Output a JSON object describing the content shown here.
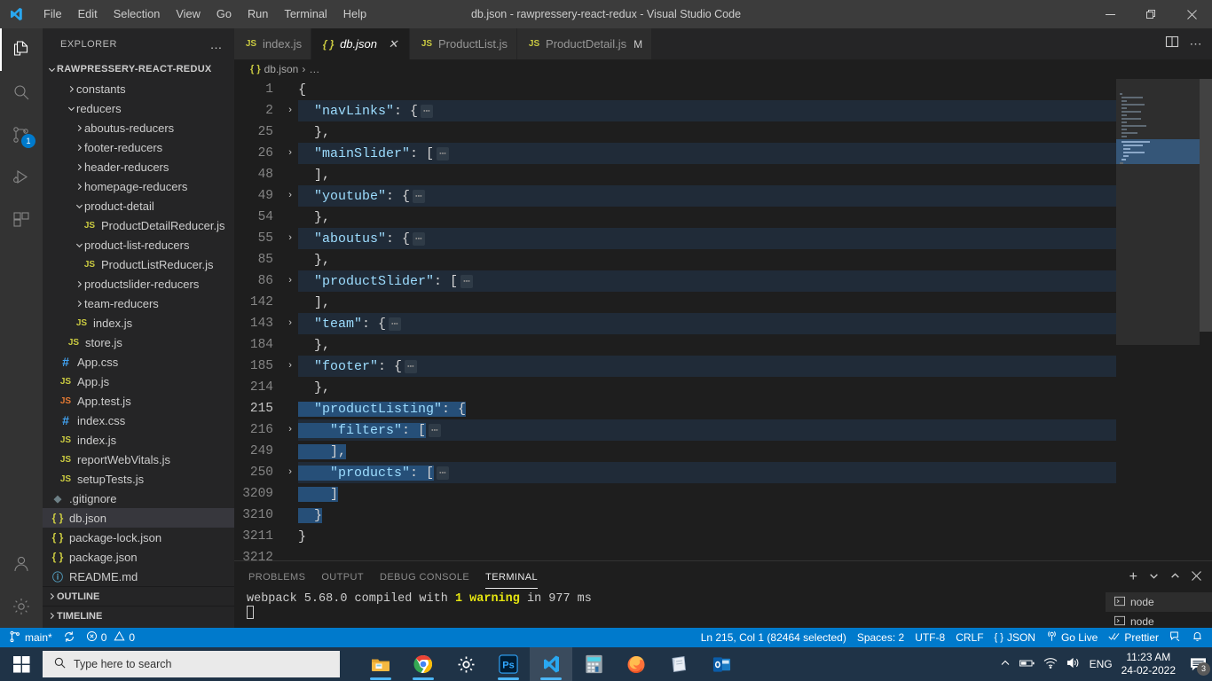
{
  "titlebar": {
    "logo_icon": "vscode-logo-icon",
    "menus": [
      "File",
      "Edit",
      "Selection",
      "View",
      "Go",
      "Run",
      "Terminal",
      "Help"
    ],
    "window_title": "db.json - rawpressery-react-redux - Visual Studio Code",
    "minimize_icon": "minimize-icon",
    "maximize_icon": "restore-icon",
    "close_icon": "close-icon"
  },
  "activitybar": {
    "items": [
      {
        "icon": "explorer-files-icon",
        "active": true,
        "badge": ""
      },
      {
        "icon": "search-icon",
        "active": false,
        "badge": ""
      },
      {
        "icon": "source-control-icon",
        "active": false,
        "badge": "1"
      },
      {
        "icon": "run-and-debug-icon",
        "active": false,
        "badge": ""
      },
      {
        "icon": "extensions-icon",
        "active": false,
        "badge": ""
      }
    ],
    "bottom": [
      {
        "icon": "accounts-icon"
      },
      {
        "icon": "gear-icon"
      }
    ]
  },
  "sidebar": {
    "title": "EXPLORER",
    "more_actions": "…",
    "root": "RAWPRESSERY-REACT-REDUX",
    "tree": [
      {
        "label": "constants",
        "type": "folder",
        "depth": 2,
        "expanded": false
      },
      {
        "label": "reducers",
        "type": "folder",
        "depth": 2,
        "expanded": true
      },
      {
        "label": "aboutus-reducers",
        "type": "folder",
        "depth": 3,
        "expanded": false
      },
      {
        "label": "footer-reducers",
        "type": "folder",
        "depth": 3,
        "expanded": false
      },
      {
        "label": "header-reducers",
        "type": "folder",
        "depth": 3,
        "expanded": false
      },
      {
        "label": "homepage-reducers",
        "type": "folder",
        "depth": 3,
        "expanded": false
      },
      {
        "label": "product-detail",
        "type": "folder",
        "depth": 3,
        "expanded": true
      },
      {
        "label": "ProductDetailReducer.js",
        "type": "js",
        "depth": 4
      },
      {
        "label": "product-list-reducers",
        "type": "folder",
        "depth": 3,
        "expanded": true
      },
      {
        "label": "ProductListReducer.js",
        "type": "js",
        "depth": 4
      },
      {
        "label": "productslider-reducers",
        "type": "folder",
        "depth": 3,
        "expanded": false
      },
      {
        "label": "team-reducers",
        "type": "folder",
        "depth": 3,
        "expanded": false
      },
      {
        "label": "index.js",
        "type": "js",
        "depth": 3
      },
      {
        "label": "store.js",
        "type": "js",
        "depth": 2
      },
      {
        "label": "App.css",
        "type": "css",
        "depth": 1
      },
      {
        "label": "App.js",
        "type": "js",
        "depth": 1
      },
      {
        "label": "App.test.js",
        "type": "jstest",
        "depth": 1
      },
      {
        "label": "index.css",
        "type": "css",
        "depth": 1
      },
      {
        "label": "index.js",
        "type": "js",
        "depth": 1
      },
      {
        "label": "reportWebVitals.js",
        "type": "js",
        "depth": 1
      },
      {
        "label": "setupTests.js",
        "type": "js",
        "depth": 1
      },
      {
        "label": ".gitignore",
        "type": "git",
        "depth": 0
      },
      {
        "label": "db.json",
        "type": "json",
        "depth": 0,
        "selected": true
      },
      {
        "label": "package-lock.json",
        "type": "json",
        "depth": 0
      },
      {
        "label": "package.json",
        "type": "json",
        "depth": 0
      },
      {
        "label": "README.md",
        "type": "md",
        "depth": 0
      }
    ],
    "sections": [
      "OUTLINE",
      "TIMELINE"
    ]
  },
  "editor": {
    "tabs": [
      {
        "label": "index.js",
        "icon": "js-file-icon",
        "active": false,
        "dirty": false,
        "modified": ""
      },
      {
        "label": "db.json",
        "icon": "json-file-icon",
        "active": true,
        "dirty": false,
        "modified": ""
      },
      {
        "label": "ProductList.js",
        "icon": "js-file-icon",
        "active": false,
        "dirty": false,
        "modified": ""
      },
      {
        "label": "ProductDetail.js",
        "icon": "js-file-icon",
        "active": false,
        "dirty": false,
        "modified": "M"
      }
    ],
    "close_icon": "close-icon",
    "split_editor_icon": "split-editor-icon",
    "more_actions_icon": "more-actions-icon",
    "breadcrumb": {
      "file": "db.json",
      "separator": "›",
      "rest": "…"
    },
    "lines": [
      {
        "num": "1",
        "fold": "",
        "indent": 0,
        "code": "{",
        "type": "plain"
      },
      {
        "num": "2",
        "fold": "›",
        "indent": 1,
        "key": "\"navLinks\"",
        "after": ": {",
        "folded": true
      },
      {
        "num": "25",
        "fold": "",
        "indent": 1,
        "code": "},",
        "type": "plain"
      },
      {
        "num": "26",
        "fold": "›",
        "indent": 1,
        "key": "\"mainSlider\"",
        "after": ": [",
        "folded": true
      },
      {
        "num": "48",
        "fold": "",
        "indent": 1,
        "code": "],",
        "type": "plain"
      },
      {
        "num": "49",
        "fold": "›",
        "indent": 1,
        "key": "\"youtube\"",
        "after": ": {",
        "folded": true
      },
      {
        "num": "54",
        "fold": "",
        "indent": 1,
        "code": "},",
        "type": "plain"
      },
      {
        "num": "55",
        "fold": "›",
        "indent": 1,
        "key": "\"aboutus\"",
        "after": ": {",
        "folded": true
      },
      {
        "num": "85",
        "fold": "",
        "indent": 1,
        "code": "},",
        "type": "plain"
      },
      {
        "num": "86",
        "fold": "›",
        "indent": 1,
        "key": "\"productSlider\"",
        "after": ": [",
        "folded": true
      },
      {
        "num": "142",
        "fold": "",
        "indent": 1,
        "code": "],",
        "type": "plain"
      },
      {
        "num": "143",
        "fold": "›",
        "indent": 1,
        "key": "\"team\"",
        "after": ": {",
        "folded": true
      },
      {
        "num": "184",
        "fold": "",
        "indent": 1,
        "code": "},",
        "type": "plain"
      },
      {
        "num": "185",
        "fold": "›",
        "indent": 1,
        "key": "\"footer\"",
        "after": ": {",
        "folded": true
      },
      {
        "num": "214",
        "fold": "",
        "indent": 1,
        "code": "},",
        "type": "plain"
      },
      {
        "num": "215",
        "fold": "",
        "indent": 1,
        "key": "\"productListing\"",
        "after": ": {",
        "selected": true,
        "current": true
      },
      {
        "num": "216",
        "fold": "›",
        "indent": 2,
        "key": "\"filters\"",
        "after": ": [",
        "folded": true,
        "selected": true
      },
      {
        "num": "249",
        "fold": "",
        "indent": 2,
        "code": "],",
        "type": "plain",
        "selected": true
      },
      {
        "num": "250",
        "fold": "›",
        "indent": 2,
        "key": "\"products\"",
        "after": ": [",
        "folded": true,
        "selected": true
      },
      {
        "num": "3209",
        "fold": "",
        "indent": 2,
        "code": "]",
        "type": "plain",
        "selected": true
      },
      {
        "num": "3210",
        "fold": "",
        "indent": 1,
        "code": "}",
        "type": "plain",
        "selected": true
      },
      {
        "num": "3211",
        "fold": "",
        "indent": 0,
        "code": "}",
        "type": "plain"
      },
      {
        "num": "3212",
        "fold": "",
        "indent": 0,
        "code": "",
        "type": "plain"
      }
    ]
  },
  "panel": {
    "tabs": [
      "PROBLEMS",
      "OUTPUT",
      "DEBUG CONSOLE",
      "TERMINAL"
    ],
    "active_tab": "TERMINAL",
    "actions": {
      "new_terminal_icon": "plus-icon",
      "terminal_dropdown_icon": "chevron-down-icon",
      "maximize_icon": "chevron-up-icon",
      "close_icon": "close-icon"
    },
    "terminal_output": {
      "prefix": "webpack 5.68.0 compiled with ",
      "warning": "1 warning",
      "suffix": " in 977 ms"
    },
    "terminal_list": [
      {
        "label": "node",
        "icon": "terminal-icon",
        "active": true
      },
      {
        "label": "node",
        "icon": "terminal-icon",
        "active": false
      }
    ]
  },
  "statusbar": {
    "left": [
      {
        "icon": "remote-branch-icon",
        "label": "main*"
      },
      {
        "icon": "sync-icon",
        "label": ""
      },
      {
        "icon": "error-icon",
        "label": "0",
        "icon2": "warning-icon",
        "label2": "0"
      }
    ],
    "branch": "main*",
    "errors": "0",
    "warnings": "0",
    "right": [
      {
        "name": "cursor-position",
        "label": "Ln 215, Col 1 (82464 selected)"
      },
      {
        "name": "indentation",
        "label": "Spaces: 2"
      },
      {
        "name": "encoding",
        "label": "UTF-8"
      },
      {
        "name": "eol",
        "label": "CRLF"
      },
      {
        "name": "language-mode",
        "label": "JSON",
        "icon": "json-icon"
      },
      {
        "name": "go-live",
        "label": "Go Live",
        "icon": "broadcast-icon"
      },
      {
        "name": "prettier",
        "label": "Prettier",
        "icon": "check-check-icon"
      },
      {
        "name": "feedback",
        "label": "",
        "icon": "feedback-icon"
      },
      {
        "name": "notifications",
        "label": "",
        "icon": "bell-icon"
      }
    ]
  },
  "taskbar": {
    "start_icon": "windows-start-icon",
    "search_placeholder": "Type here to search",
    "search_icon": "search-icon",
    "apps": [
      {
        "name": "file-explorer-icon",
        "running": true
      },
      {
        "name": "google-chrome-icon",
        "running": true
      },
      {
        "name": "settings-gear-icon",
        "running": false
      },
      {
        "name": "photoshop-icon",
        "running": true
      },
      {
        "name": "visual-studio-code-icon",
        "running": true,
        "active": true
      },
      {
        "name": "calculator-icon",
        "running": false
      },
      {
        "name": "firefox-icon",
        "running": false
      },
      {
        "name": "sticky-notes-icon",
        "running": false
      },
      {
        "name": "outlook-icon",
        "running": false
      }
    ],
    "tray": {
      "show_hidden_icon": "chevron-up-icon",
      "battery_icon": "battery-icon",
      "network_icon": "wifi-icon",
      "volume_icon": "speaker-icon",
      "language": "ENG",
      "time": "11:23 AM",
      "date": "24-02-2022",
      "notification_icon": "notifications-icon",
      "notification_count": "3"
    }
  }
}
